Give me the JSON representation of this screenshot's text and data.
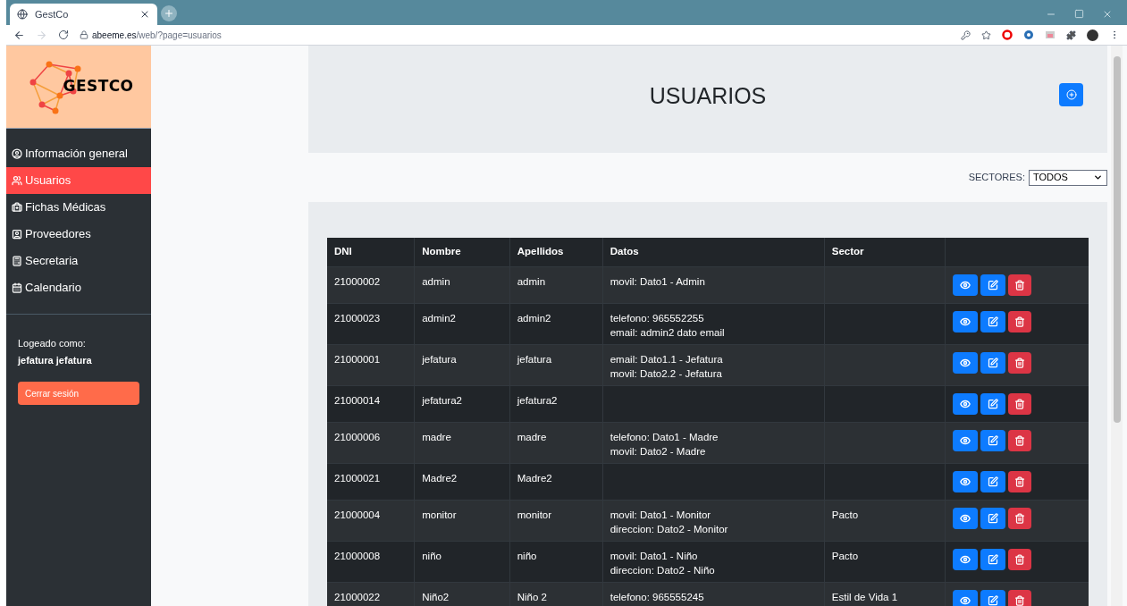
{
  "browser": {
    "tab_title": "GestCo",
    "url_host": "abeeme.es",
    "url_path": "/web/?page=usuarios"
  },
  "sidebar": {
    "logo_text": "GESTCO",
    "items": [
      {
        "label": "Información general",
        "selected": false
      },
      {
        "label": "Usuarios",
        "selected": true
      },
      {
        "label": "Fichas Médicas",
        "selected": false
      },
      {
        "label": "Proveedores",
        "selected": false
      },
      {
        "label": "Secretaria",
        "selected": false
      },
      {
        "label": "Calendario",
        "selected": false
      }
    ],
    "logged_label": "Logeado como:",
    "logged_user": "jefatura jefatura",
    "logout": "Cerrar sesión"
  },
  "header": {
    "title": "USUARIOS"
  },
  "filter": {
    "label": "SECTORES:",
    "value": "TODOS"
  },
  "table": {
    "columns": [
      "DNI",
      "Nombre",
      "Apellidos",
      "Datos",
      "Sector"
    ],
    "rows": [
      {
        "dni": "21000002",
        "nombre": "admin",
        "apellidos": "admin",
        "datos": [
          "movil: Dato1 - Admin"
        ]
      },
      {
        "dni": "21000023",
        "nombre": "admin2",
        "apellidos": "admin2",
        "datos": [
          "telefono: 965552255",
          "email: admin2 dato email"
        ]
      },
      {
        "dni": "21000001",
        "nombre": "jefatura",
        "apellidos": "jefatura",
        "datos": [
          "email: Dato1.1 - Jefatura",
          "movil: Dato2.2 - Jefatura"
        ]
      },
      {
        "dni": "21000014",
        "nombre": "jefatura2",
        "apellidos": "jefatura2",
        "datos": []
      },
      {
        "dni": "21000006",
        "nombre": "madre",
        "apellidos": "madre",
        "datos": [
          "telefono: Dato1 - Madre",
          "movil: Dato2 - Madre"
        ]
      },
      {
        "dni": "21000021",
        "nombre": "Madre2",
        "apellidos": "Madre2",
        "datos": []
      },
      {
        "dni": "21000004",
        "nombre": "monitor",
        "apellidos": "monitor",
        "datos": [
          "movil: Dato1 - Monitor",
          "direccion: Dato2 - Monitor"
        ],
        "sector": "Pacto"
      },
      {
        "dni": "21000008",
        "nombre": "niño",
        "apellidos": "niño",
        "datos": [
          "movil: Dato1 - Niño",
          "direccion: Dato2 - Niño"
        ],
        "sector": "Pacto"
      },
      {
        "dni": "21000022",
        "nombre": "Niño2",
        "apellidos": "Niño 2",
        "datos": [
          "telefono: 965555245"
        ],
        "sector": "Estil de Vida 1"
      }
    ]
  }
}
